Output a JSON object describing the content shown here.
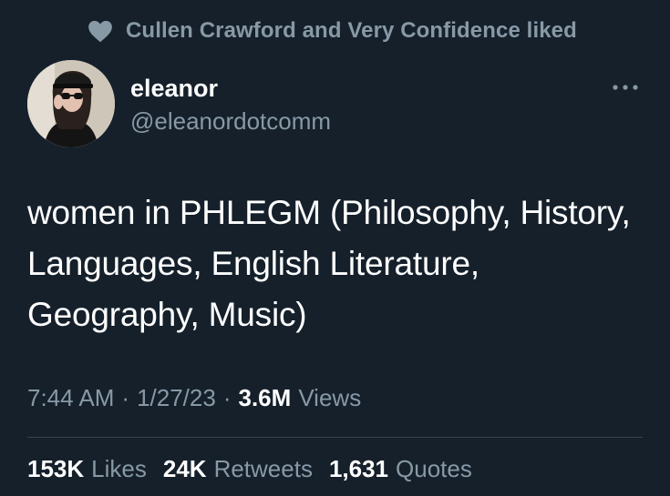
{
  "social_context": {
    "icon": "heart-icon",
    "text": "Cullen Crawford and Very Confidence liked"
  },
  "author": {
    "name": "eleanor",
    "handle": "@eleanordotcomm"
  },
  "more_icon": "more-horizontal-icon",
  "tweet": {
    "text": "women in PHLEGM (Philosophy, History, Languages, English Literature, Geography, Music)"
  },
  "meta": {
    "time": "7:44 AM",
    "date": "1/27/23",
    "views_count": "3.6M",
    "views_label": "Views"
  },
  "stats": {
    "likes": {
      "count": "153K",
      "label": "Likes"
    },
    "retweets": {
      "count": "24K",
      "label": "Retweets"
    },
    "quotes": {
      "count": "1,631",
      "label": "Quotes"
    }
  },
  "colors": {
    "background": "#15202b",
    "secondary_text": "#8899a6",
    "primary_text": "#ffffff",
    "divider": "#38444d"
  }
}
